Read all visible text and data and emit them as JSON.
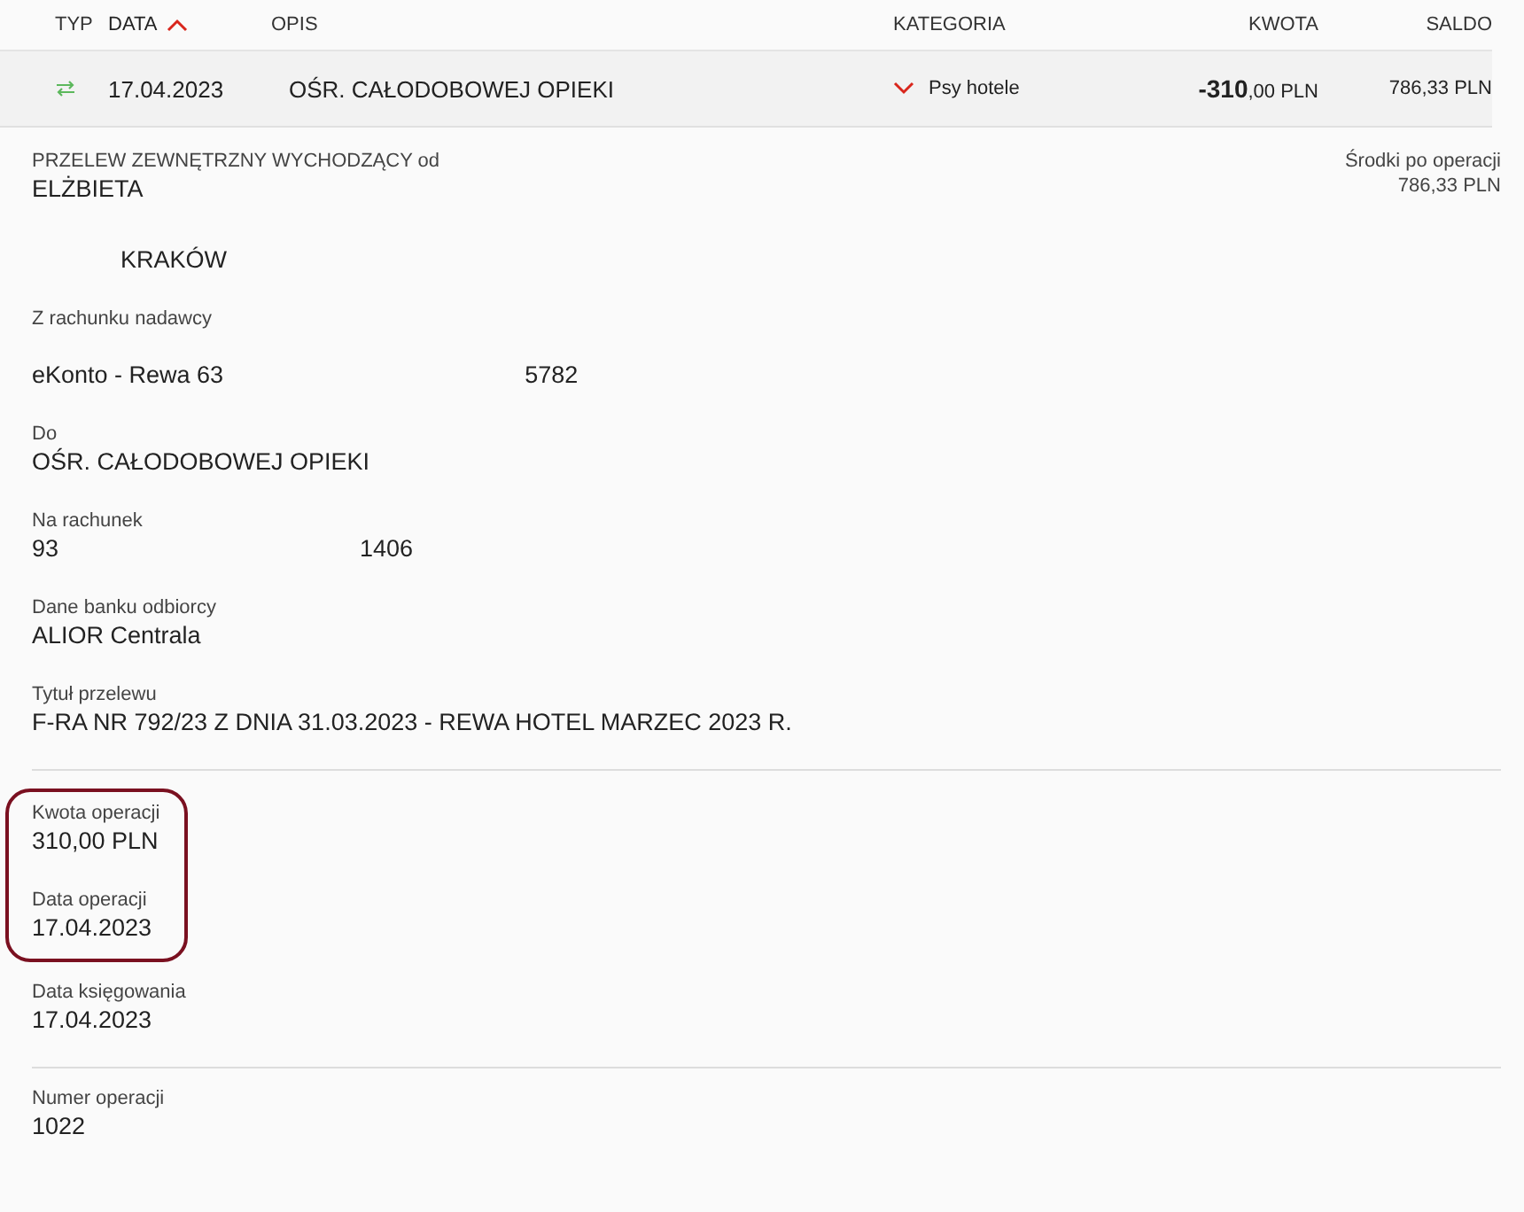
{
  "columns": [
    {
      "label": "TYP",
      "sorted": false
    },
    {
      "label": "DATA",
      "sorted": true
    },
    {
      "label": "OPIS",
      "sorted": false
    },
    {
      "label": "KATEGORIA",
      "sorted": false
    },
    {
      "label": "KWOTA",
      "sorted": false
    },
    {
      "label": "SALDO",
      "sorted": false
    }
  ],
  "row": {
    "date": "17.04.2023",
    "description": "OŚR. CAŁODOBOWEJ OPIEKI",
    "category": "Psy hotele",
    "expanded": true,
    "amount_main": "-310",
    "amount_rest": ",00 PLN",
    "balance": "786,33 PLN"
  },
  "details": {
    "title": "PRZELEW ZEWNĘTRZNY WYCHODZĄCY od",
    "balance_label": "Środki po operacji",
    "balance_value": "786,33 PLN",
    "sender_lines": [
      "ELŻBIETA",
      "KRAKÓW"
    ],
    "sections": [
      {
        "divider": false,
        "groups": [
          {
            "highlighted": false,
            "fields": [
              {
                "label": "Z rachunku nadawcy",
                "parts": [
                  "eKonto - Rewa 63",
                  "5782"
                ]
              },
              {
                "label": "Do",
                "parts": [
                  "OŚR. CAŁODOBOWEJ OPIEKI"
                ]
              },
              {
                "label": "Na rachunek",
                "parts": [
                  "93",
                  "1406"
                ]
              },
              {
                "label": "Dane banku odbiorcy",
                "parts": [
                  "ALIOR Centrala"
                ]
              },
              {
                "label": "Tytuł przelewu",
                "parts": [
                  "F-RA NR 792/23 Z DNIA 31.03.2023 - REWA HOTEL MARZEC 2023 R."
                ]
              }
            ]
          }
        ]
      },
      {
        "divider": true,
        "groups": [
          {
            "highlighted": true,
            "fields": [
              {
                "label": "Kwota operacji",
                "parts": [
                  "310,00 PLN"
                ]
              },
              {
                "label": "Data operacji",
                "parts": [
                  "17.04.2023"
                ]
              }
            ]
          },
          {
            "highlighted": false,
            "fields": [
              {
                "label": "Data księgowania",
                "parts": [
                  "17.04.2023"
                ]
              }
            ]
          }
        ]
      },
      {
        "divider": true,
        "groups": [
          {
            "highlighted": false,
            "fields": [
              {
                "label": "Numer operacji",
                "parts": [
                  "1022"
                ]
              }
            ]
          }
        ]
      }
    ]
  }
}
